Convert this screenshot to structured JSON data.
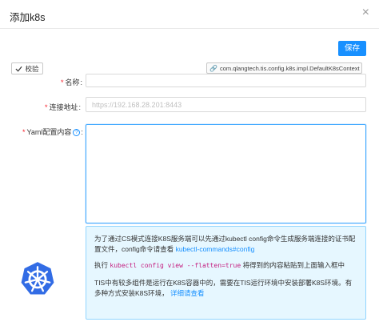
{
  "dialog": {
    "title": "添加k8s",
    "close_glyph": "×"
  },
  "toolbar": {
    "save_label": "保存",
    "verify_label": "校验",
    "context_tag": "com.qlangtech.tis.config.k8s.impl.DefaultK8sContext"
  },
  "form": {
    "name": {
      "label": "名称",
      "required": true,
      "value": "",
      "placeholder": ""
    },
    "url": {
      "label": "连接地址",
      "required": true,
      "value": "",
      "placeholder": "https://192.168.28.201:8443"
    },
    "yaml": {
      "label": "Yaml配置内容",
      "required": true,
      "value": "",
      "help_glyph": "?"
    },
    "colon": ":"
  },
  "info": {
    "line1_prefix": "为了通过CS模式连接K8S服务端可以先通过kubectl config命令生成服务端连接的证书配置文件，config命令请查看",
    "line1_link": "kubectl-commands#config",
    "line2_prefix": "执行",
    "line2_code": "kubectl config view --flatten=true",
    "line2_suffix": "将得到的内容粘贴到上面输入框中",
    "line3_text": "TIS中有较多组件是运行在K8S容器中的，需要在TIS运行环境中安装部署K8S环境。有多种方式安装K8S环境，",
    "line3_link": "详细请查看"
  },
  "colors": {
    "primary": "#1890ff",
    "info_bg": "#e6f7ff",
    "info_border": "#91d5ff",
    "required": "#f5222d",
    "k8s_logo": "#326ce5"
  },
  "icons": {
    "verify": "check-icon",
    "context_tag": "link-icon",
    "help": "question-circle-icon",
    "logo": "kubernetes-logo-icon"
  }
}
